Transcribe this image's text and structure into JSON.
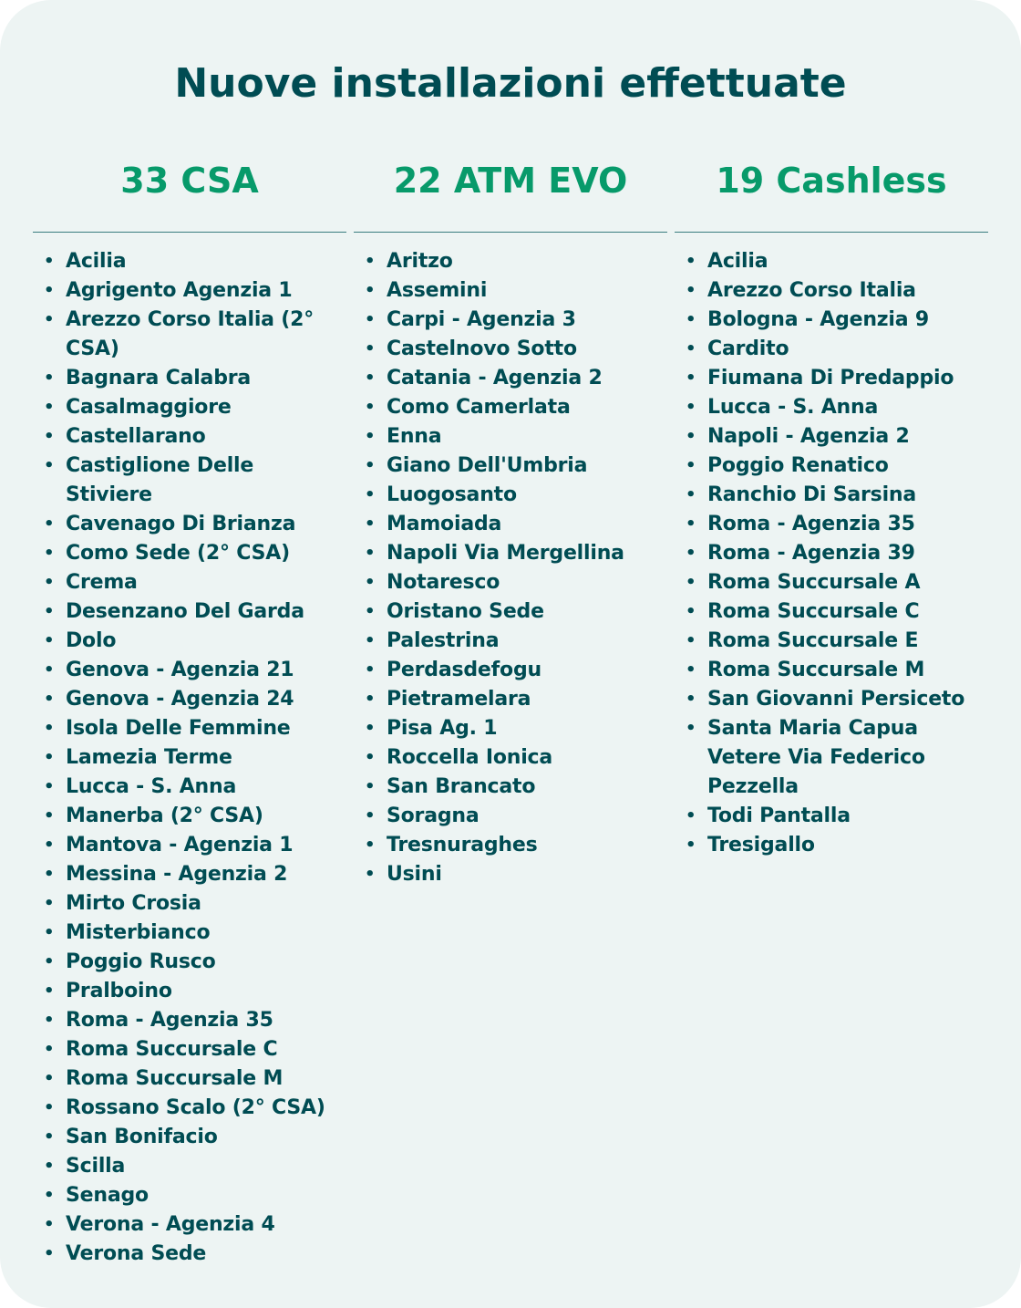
{
  "title": "Nuove installazioni effettuate",
  "columns": [
    {
      "header": "33 CSA",
      "items": [
        "Acilia",
        "Agrigento Agenzia 1",
        "Arezzo Corso Italia (2° CSA)",
        "Bagnara Calabra",
        "Casalmaggiore",
        "Castellarano",
        "Castiglione Delle Stiviere",
        "Cavenago Di Brianza",
        "Como Sede (2° CSA)",
        "Crema",
        "Desenzano Del Garda",
        "Dolo",
        "Genova - Agenzia 21",
        "Genova - Agenzia 24",
        "Isola Delle Femmine",
        "Lamezia Terme",
        "Lucca - S. Anna",
        "Manerba (2° CSA)",
        "Mantova - Agenzia 1",
        "Messina - Agenzia 2",
        "Mirto Crosia",
        "Misterbianco",
        "Poggio Rusco",
        "Pralboino",
        "Roma - Agenzia 35",
        "Roma Succursale C",
        "Roma Succursale M",
        "Rossano Scalo (2° CSA)",
        "San Bonifacio",
        "Scilla",
        "Senago",
        "Verona - Agenzia 4",
        "Verona Sede"
      ]
    },
    {
      "header": "22 ATM EVO",
      "items": [
        "Aritzo",
        "Assemini",
        "Carpi - Agenzia 3",
        "Castelnovo Sotto",
        "Catania - Agenzia 2",
        "Como Camerlata",
        "Enna",
        "Giano Dell'Umbria",
        "Luogosanto",
        "Mamoiada",
        "Napoli Via Mergellina",
        "Notaresco",
        "Oristano Sede",
        "Palestrina",
        "Perdasdefogu",
        "Pietramelara",
        "Pisa Ag. 1",
        "Roccella Ionica",
        "San Brancato",
        "Soragna",
        "Tresnuraghes",
        "Usini"
      ]
    },
    {
      "header": "19 Cashless",
      "items": [
        "Acilia",
        "Arezzo Corso Italia",
        "Bologna - Agenzia 9",
        "Cardito",
        "Fiumana Di Predappio",
        "Lucca - S. Anna",
        "Napoli - Agenzia 2",
        "Poggio Renatico",
        "Ranchio Di Sarsina",
        "Roma - Agenzia 35",
        "Roma - Agenzia 39",
        "Roma Succursale A",
        "Roma Succursale C",
        "Roma Succursale E",
        "Roma Succursale M",
        "San Giovanni Persiceto",
        "Santa Maria Capua Vetere Via Federico Pezzella",
        "Todi Pantalla",
        "Tresigallo"
      ]
    }
  ]
}
